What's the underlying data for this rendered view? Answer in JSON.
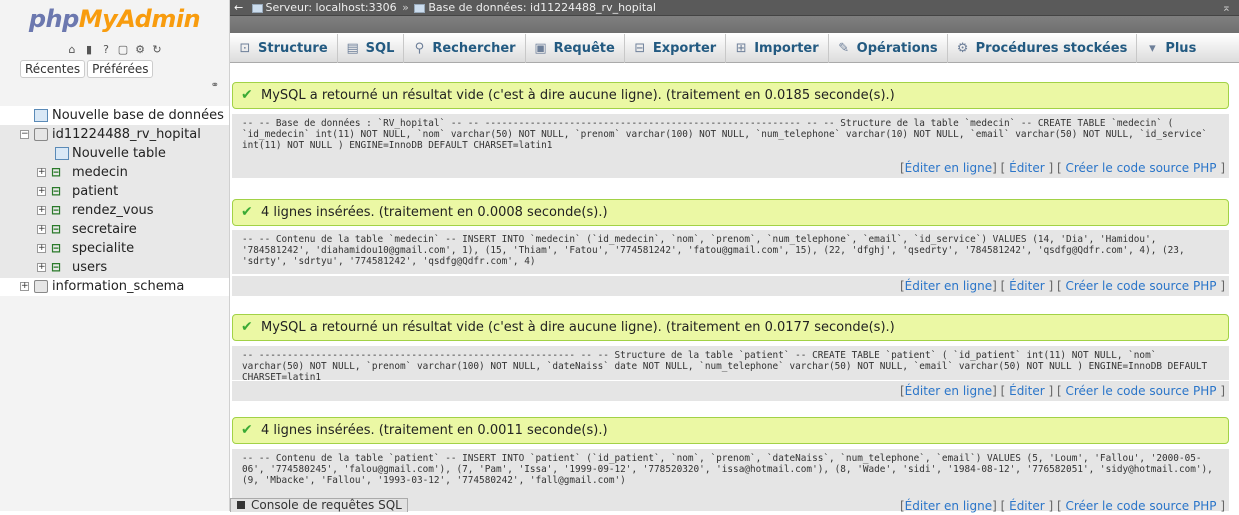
{
  "logo": {
    "part1": "php",
    "part2": "MyAdmin"
  },
  "nav_tabs": [
    "Récentes",
    "Préférées"
  ],
  "nav_link_icon": "link-icon",
  "tree": {
    "new_db": "Nouvelle base de données",
    "db1": "id11224488_rv_hopital",
    "new_table": "Nouvelle table",
    "tables": [
      "medecin",
      "patient",
      "rendez_vous",
      "secretaire",
      "specialite",
      "users"
    ],
    "db2": "information_schema"
  },
  "breadcrumb": {
    "server": "Serveur: localhost:3306",
    "database": "Base de données: id11224488_rv_hopital"
  },
  "menu": [
    {
      "label": "Structure",
      "icon": "structure-icon"
    },
    {
      "label": "SQL",
      "icon": "sql-icon"
    },
    {
      "label": "Rechercher",
      "icon": "search-icon"
    },
    {
      "label": "Requête",
      "icon": "query-icon"
    },
    {
      "label": "Exporter",
      "icon": "export-icon"
    },
    {
      "label": "Importer",
      "icon": "import-icon"
    },
    {
      "label": "Opérations",
      "icon": "wrench-icon"
    },
    {
      "label": "Procédures stockées",
      "icon": "routines-icon"
    },
    {
      "label": "Plus",
      "icon": "chevron-down-icon"
    }
  ],
  "results": [
    {
      "message": "MySQL a retourné un résultat vide (c'est à dire aucune ligne). (traitement en 0.0185 seconde(s).)",
      "sql": "-- -- Base de données : `RV_hopital` -- -- -------------------------------------------------------- -- -- Structure de la table `medecin` -- CREATE TABLE `medecin` ( `id_medecin` int(11) NOT NULL, `nom` varchar(50) NOT NULL, `prenom` varchar(100) NOT NULL, `num_telephone` varchar(10) NOT NULL, `email` varchar(50) NOT NULL, `id_service` int(11) NOT NULL ) ENGINE=InnoDB DEFAULT CHARSET=latin1"
    },
    {
      "message": "4 lignes insérées. (traitement en 0.0008 seconde(s).)",
      "sql": "-- -- Contenu de la table `medecin` -- INSERT INTO `medecin` (`id_medecin`, `nom`, `prenom`, `num_telephone`, `email`, `id_service`) VALUES (14, 'Dia', 'Hamidou', '784581242', 'diahamidou10@gmail.com', 1), (15, 'Thiam', 'Fatou', '774581242', 'fatou@gmail.com', 15), (22, 'dfghj', 'qsedrty', '784581242', 'qsdfg@Qdfr.com', 4), (23, 'sdrty', 'sdrtyu', '774581242', 'qsdfg@Qdfr.com', 4)"
    },
    {
      "message": "MySQL a retourné un résultat vide (c'est à dire aucune ligne). (traitement en 0.0177 seconde(s).)",
      "sql": "-- -------------------------------------------------------- -- -- Structure de la table `patient` -- CREATE TABLE `patient` ( `id_patient` int(11) NOT NULL, `nom` varchar(50) NOT NULL, `prenom` varchar(100) NOT NULL, `dateNaiss` date NOT NULL, `num_telephone` varchar(50) NOT NULL, `email` varchar(50) NOT NULL ) ENGINE=InnoDB DEFAULT CHARSET=latin1"
    },
    {
      "message": "4 lignes insérées. (traitement en 0.0011 seconde(s).)",
      "sql": "-- -- Contenu de la table `patient` -- INSERT INTO `patient` (`id_patient`, `nom`, `prenom`, `dateNaiss`, `num_telephone`, `email`) VALUES (5, 'Loum', 'Fallou', '2000-05-06', '774580245', 'falou@gmail.com'), (7, 'Pam', 'Issa', '1999-09-12', '778520320', 'issa@hotmail.com'), (8, 'Wade', 'sidi', '1984-08-12', '776582051', 'sidy@hotmail.com'), (9, 'Mbacke', 'Fallou', '1993-03-12', '774580242', 'fall@gmail.com')"
    }
  ],
  "result_links": {
    "inline": "Éditer en ligne",
    "edit": "Éditer",
    "php": "Créer le code source PHP"
  },
  "console_label": "Console de requêtes SQL"
}
